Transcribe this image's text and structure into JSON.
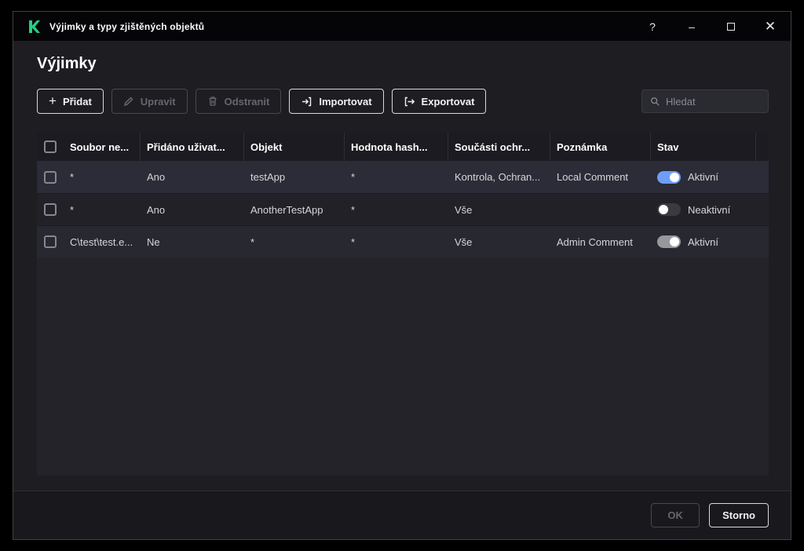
{
  "window": {
    "title": "Výjimky a typy zjištěných objektů",
    "controls": {
      "help": "?",
      "minimize": "–",
      "close": "✕"
    }
  },
  "page": {
    "title": "Výjimky"
  },
  "toolbar": {
    "add": "Přidat",
    "edit": "Upravit",
    "remove": "Odstranit",
    "import": "Importovat",
    "export": "Exportovat",
    "search_placeholder": "Hledat"
  },
  "colors": {
    "accent_green": "#23d180",
    "toggle_active_blue": "#6f9df8"
  },
  "table": {
    "columns": [
      "Soubor ne...",
      "Přidáno uživat...",
      "Objekt",
      "Hodnota hash...",
      "Součásti ochr...",
      "Poznámka",
      "Stav"
    ],
    "rows": [
      {
        "file": "*",
        "added_by_user": "Ano",
        "object": "testApp",
        "hash": "*",
        "components": "Kontrola, Ochran...",
        "comment": "Local Comment",
        "status": "Aktivní",
        "toggle": "on-blue"
      },
      {
        "file": "*",
        "added_by_user": "Ano",
        "object": "AnotherTestApp",
        "hash": "*",
        "components": "Vše",
        "comment": "",
        "status": "Neaktivní",
        "toggle": "off"
      },
      {
        "file": "C\\test\\test.e...",
        "added_by_user": "Ne",
        "object": "*",
        "hash": "*",
        "components": "Vše",
        "comment": "Admin Comment",
        "status": "Aktivní",
        "toggle": "on-gray"
      }
    ]
  },
  "footer": {
    "ok": "OK",
    "cancel": "Storno"
  }
}
